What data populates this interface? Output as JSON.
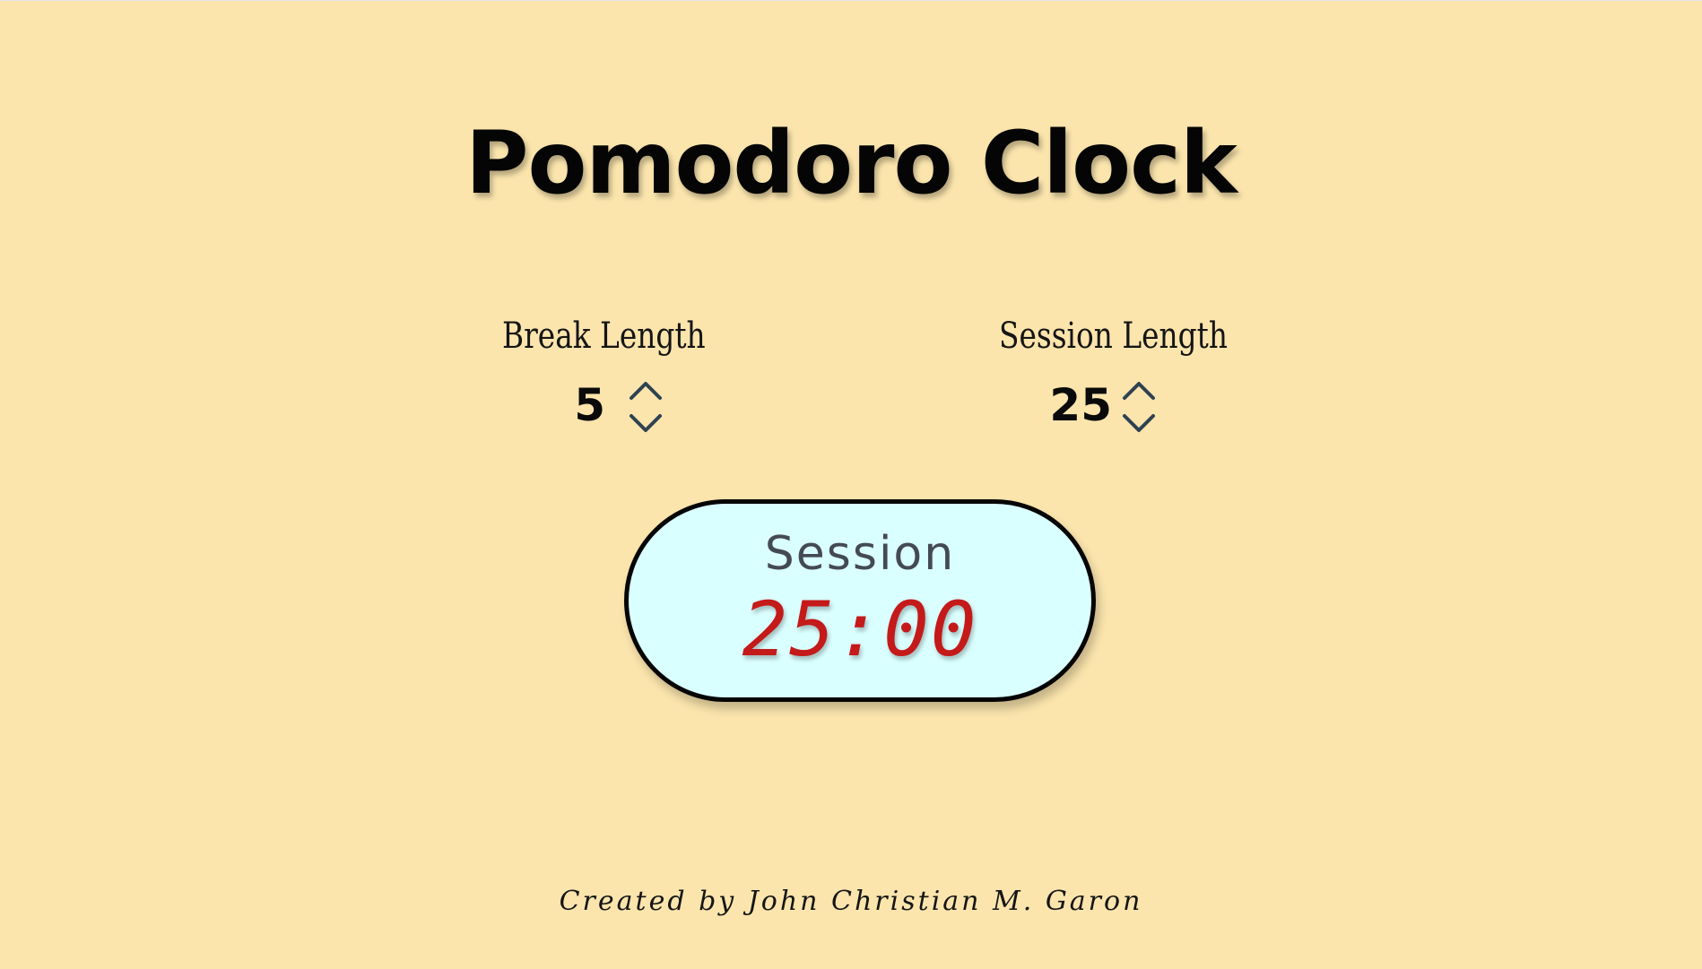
{
  "title": "Pomodoro Clock",
  "break": {
    "label": "Break Length",
    "value": "5",
    "increment_icon": "chevron-up-icon",
    "decrement_icon": "chevron-down-icon"
  },
  "session": {
    "label": "Session Length",
    "value": "25",
    "increment_icon": "chevron-up-icon",
    "decrement_icon": "chevron-down-icon"
  },
  "timer": {
    "label": "Session",
    "time": "25:00"
  },
  "footer": "Created by John Christian M. Garon",
  "colors": {
    "background": "#fbe5ad",
    "timer_fill": "#daffff",
    "timer_text": "#c41a1a",
    "arrow": "#2f4250"
  }
}
